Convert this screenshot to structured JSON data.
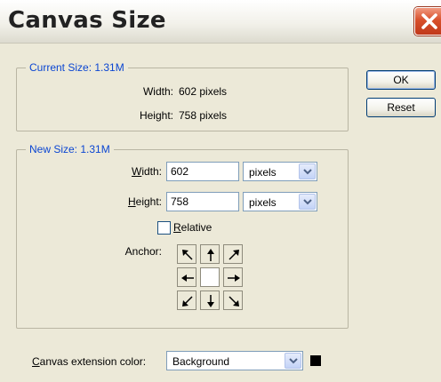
{
  "dialog": {
    "title": "Canvas Size",
    "close_icon": "close-icon"
  },
  "current_size": {
    "legend": "Current Size: 1.31M",
    "width_label": "Width:",
    "width_value": "602 pixels",
    "height_label": "Height:",
    "height_value": "758 pixels"
  },
  "new_size": {
    "legend": "New Size: 1.31M",
    "width_label_first": "W",
    "width_label_rest": "idth:",
    "width_value": "602",
    "width_unit": "pixels",
    "height_label_first": "H",
    "height_label_rest": "eight:",
    "height_value": "758",
    "height_unit": "pixels",
    "relative_first": "R",
    "relative_rest": "elative",
    "relative_checked": false,
    "anchor_label": "Anchor:"
  },
  "buttons": {
    "ok": "OK",
    "reset": "Reset"
  },
  "extension": {
    "label_first": "C",
    "label_rest": "anvas extension color:",
    "value": "Background",
    "swatch_color": "#000000"
  },
  "colors": {
    "legend_text": "#0b46d2",
    "dialog_bg": "#ece9d8",
    "close_button": "#d8502b"
  }
}
